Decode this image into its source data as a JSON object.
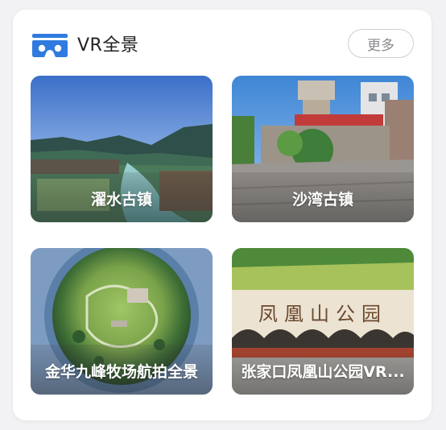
{
  "header": {
    "title": "VR全景",
    "more_label": "更多"
  },
  "tiles": [
    {
      "caption": "濯水古镇",
      "sign_text": ""
    },
    {
      "caption": "沙湾古镇",
      "sign_text": ""
    },
    {
      "caption": "金华九峰牧场航拍全景",
      "sign_text": ""
    },
    {
      "caption": "张家口凤凰山公园VR...",
      "sign_text": "凤凰山公园"
    }
  ],
  "colors": {
    "accent": "#2f7be0",
    "more_text": "#8a8a8f",
    "more_border": "#cfcfd4"
  },
  "icons": {
    "header_icon": "vr-headset-icon"
  }
}
